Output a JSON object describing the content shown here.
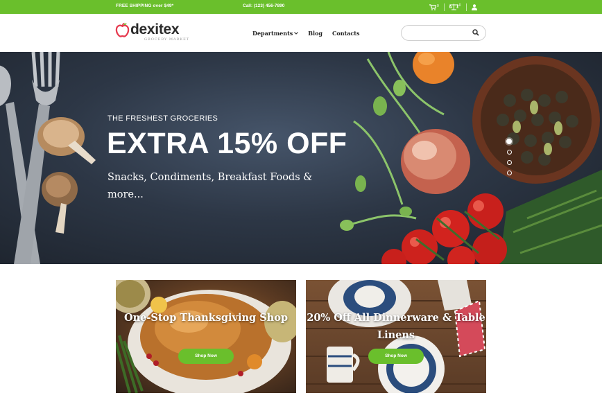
{
  "topbar": {
    "shipping": "FREE SHIPPING over $49*",
    "call": "Call: (123) 456-7890",
    "cart_count": "0",
    "compare_count": "0"
  },
  "header": {
    "logo_text": "dexitex",
    "logo_tagline": "GROCERY MARKET",
    "nav": [
      "Departments",
      "Blog",
      "Contacts"
    ],
    "search_placeholder": ""
  },
  "hero": {
    "kicker": "THE FRESHEST GROCERIES",
    "headline": "EXTRA 15% OFF",
    "subline": "Snacks, Condiments, Breakfast Foods & more...",
    "slides": 4,
    "active_slide": 1
  },
  "promos": [
    {
      "title": "One-Stop Thanksgiving Shop",
      "button": "Shop Now"
    },
    {
      "title": "20% Off All Dinnerware & Table Linens",
      "button": "Shop Now"
    }
  ],
  "colors": {
    "accent": "#6abf2c",
    "logo_red": "#e63a4f",
    "text": "#222222"
  },
  "icons": [
    "cart-icon",
    "compare-icon",
    "user-icon",
    "search-icon",
    "chevron-down-icon",
    "apple-logo-icon"
  ]
}
